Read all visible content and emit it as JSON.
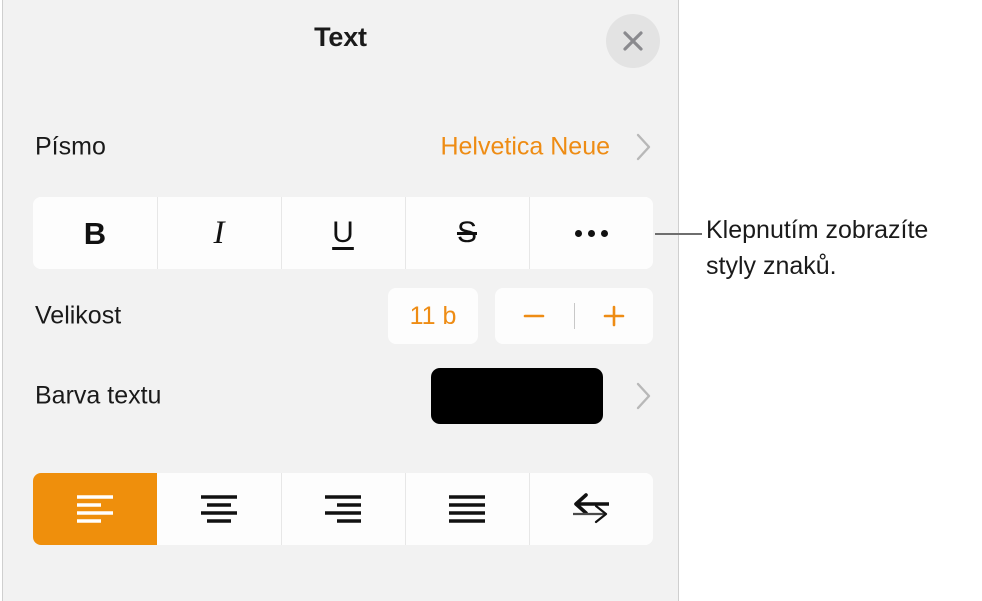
{
  "panel": {
    "title": "Text",
    "close_icon": "close-icon",
    "rows": {
      "font": {
        "label": "Písmo",
        "value": "Helvetica Neue",
        "chevron": "chevron-right-icon"
      },
      "size": {
        "label": "Velikost",
        "value": "11 b",
        "decrease_icon": "minus-icon",
        "increase_icon": "plus-icon"
      },
      "color": {
        "label": "Barva textu",
        "swatch_color": "#000000",
        "chevron": "chevron-right-icon"
      }
    },
    "character_styles": [
      {
        "id": "bold",
        "glyph": "B",
        "icon": "bold-icon",
        "selected": false
      },
      {
        "id": "italic",
        "glyph": "I",
        "icon": "italic-icon",
        "selected": false
      },
      {
        "id": "underline",
        "glyph": "U",
        "icon": "underline-icon",
        "selected": false
      },
      {
        "id": "strikethrough",
        "glyph": "S",
        "icon": "strikethrough-icon",
        "selected": false
      },
      {
        "id": "more",
        "glyph": "•••",
        "icon": "ellipsis-icon",
        "selected": false
      }
    ],
    "alignment": [
      {
        "id": "align-left",
        "icon": "align-left-icon",
        "selected": true
      },
      {
        "id": "align-center",
        "icon": "align-center-icon",
        "selected": false
      },
      {
        "id": "align-right",
        "icon": "align-right-icon",
        "selected": false
      },
      {
        "id": "align-justify",
        "icon": "align-justify-icon",
        "selected": false
      },
      {
        "id": "text-direction",
        "icon": "text-direction-icon",
        "selected": false
      }
    ]
  },
  "callout": {
    "text": "Klepnutím zobrazíte styly znaků."
  },
  "colors": {
    "accent": "#ee8c14",
    "selected_fill": "#ef8f0c",
    "panel_background": "#f2f2f2",
    "control_background": "#fdfdfd",
    "text": "#1a1a1a",
    "leader_line": "#6e6e6e"
  }
}
